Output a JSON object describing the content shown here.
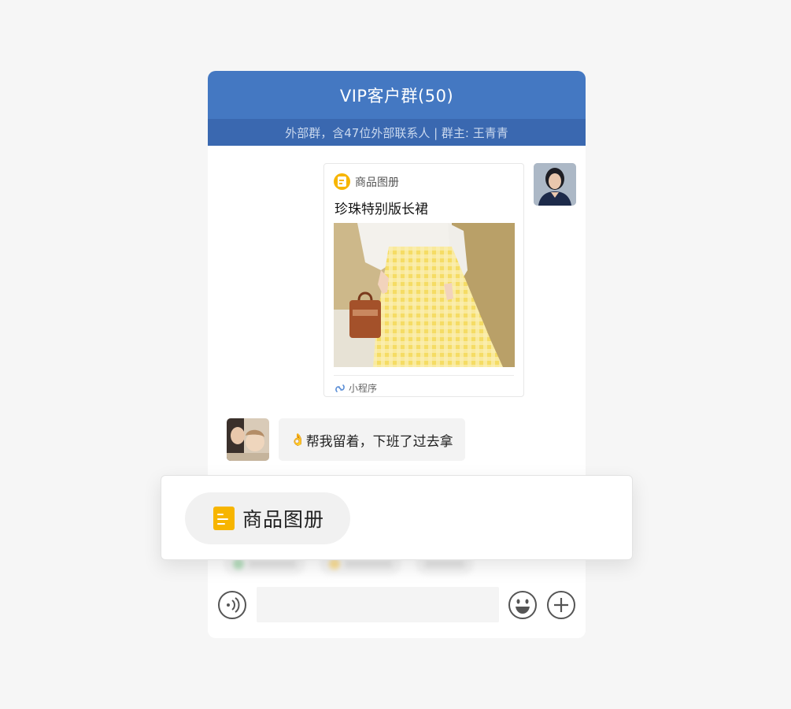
{
  "header": {
    "title": "VIP客户群(50)",
    "subtitle": "外部群，含47位外部联系人 | 群主: 王青青"
  },
  "messages": [
    {
      "type": "mini_program_card",
      "sender": "self",
      "app_name": "商品图册",
      "product_title": "珍珠特别版长裙",
      "footer_label": "小程序"
    },
    {
      "type": "text",
      "sender": "other",
      "emoji": "👌",
      "text": "帮我留着，下班了过去拿"
    }
  ],
  "toolbar_popup": {
    "label": "商品图册",
    "icon": "document-list-icon"
  },
  "input_bar": {
    "value": "",
    "placeholder": ""
  },
  "colors": {
    "header_bg": "#4478c2",
    "subheader_bg": "#3a68b0",
    "accent_yellow": "#f7b500"
  }
}
